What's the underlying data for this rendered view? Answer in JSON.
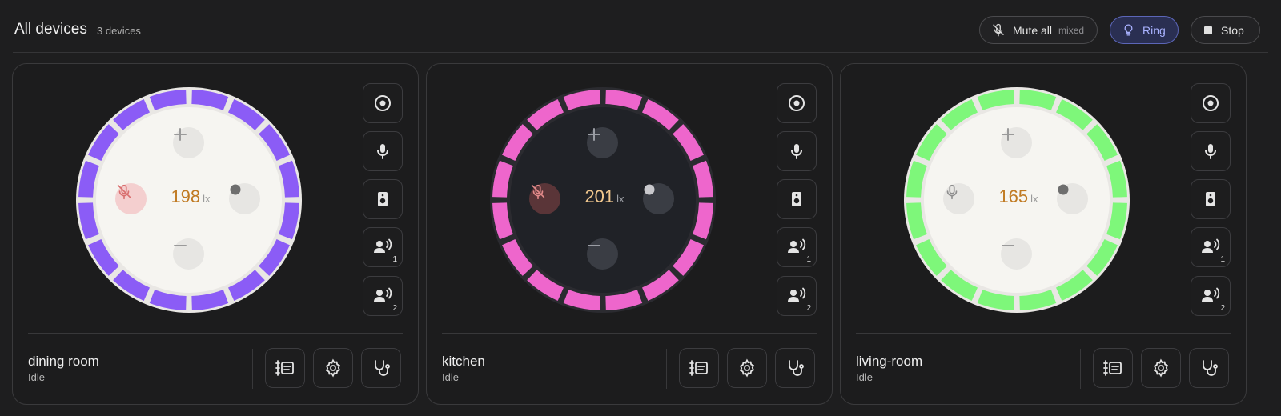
{
  "header": {
    "title": "All devices",
    "count": "3 devices",
    "mute_all": {
      "label": "Mute all",
      "state": "mixed"
    },
    "ring_label": "Ring",
    "stop_label": "Stop"
  },
  "colors": {
    "ring_accent": "#a9b2ff",
    "reading_light": "#c07a22",
    "reading_dark": "#f2c88e"
  },
  "devices": [
    {
      "name": "dining room",
      "status": "Idle",
      "ring_color": "#8b5cf6",
      "face": "light",
      "reading": "198",
      "unit": "lx",
      "mic_muted": true,
      "side_badges": [
        "1",
        "2"
      ]
    },
    {
      "name": "kitchen",
      "status": "Idle",
      "ring_color": "#ee66cc",
      "face": "dark",
      "reading": "201",
      "unit": "lx",
      "mic_muted": true,
      "side_badges": [
        "1",
        "2"
      ]
    },
    {
      "name": "living-room",
      "status": "Idle",
      "ring_color": "#7ef77a",
      "face": "light",
      "reading": "165",
      "unit": "lx",
      "mic_muted": false,
      "side_badges": [
        "1",
        "2"
      ]
    }
  ]
}
